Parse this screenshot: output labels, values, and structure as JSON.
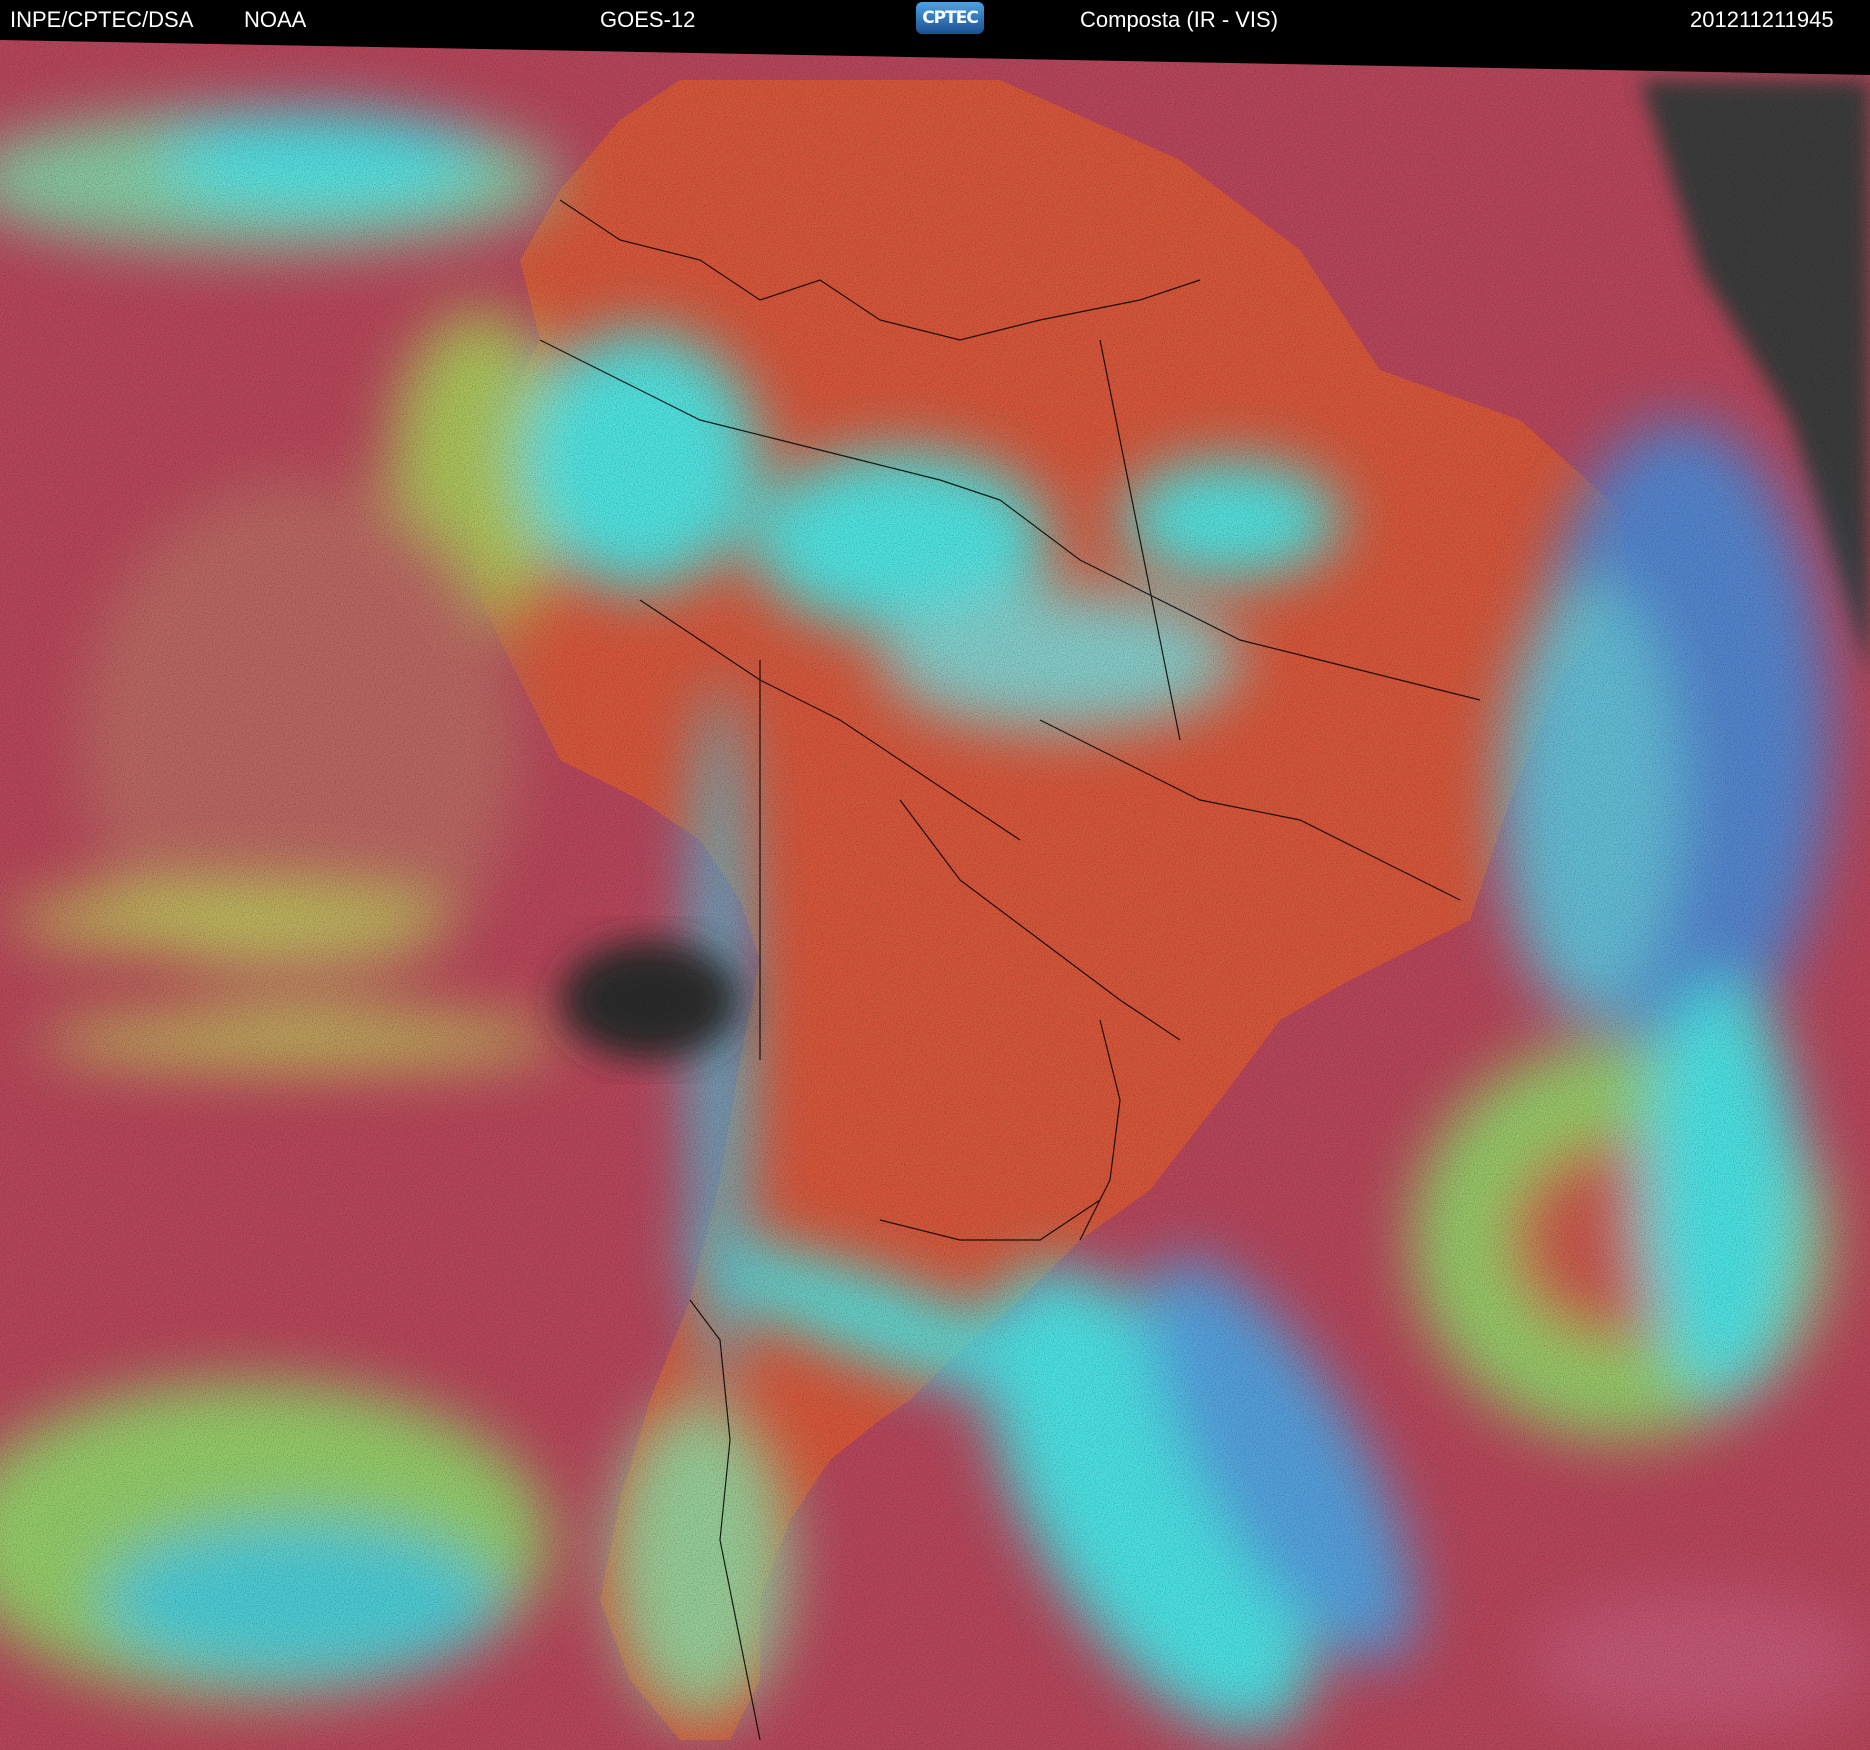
{
  "header": {
    "organization": "INPE/CPTEC/DSA",
    "agency": "NOAA",
    "satellite": "GOES-12",
    "logo_text": "CPTEC",
    "product": "Composta (IR - VIS)",
    "timestamp": "201211211945"
  },
  "colors": {
    "ocean_clear": "#b5455a",
    "land_clear": "#d4553a",
    "high_cloud": "#3ff0f0",
    "mid_cloud": "#8fd86a",
    "low_cloud_blue": "#4a8ad8",
    "night_side": "#3a3a3a",
    "borders": "#000000"
  }
}
